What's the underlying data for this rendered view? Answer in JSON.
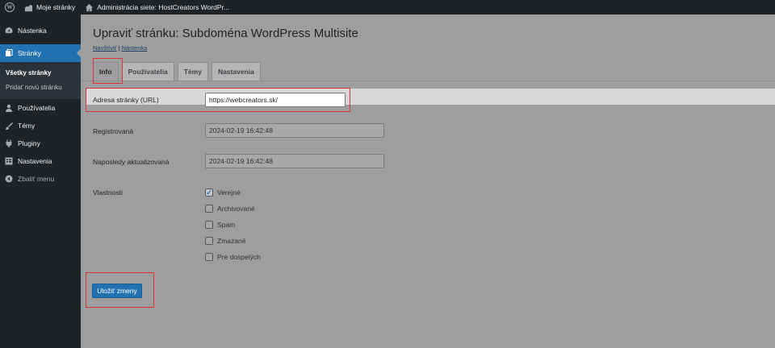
{
  "adminbar": {
    "my_sites": "Moje stránky",
    "site_name": "Administrácia siete: HostCreators WordPr..."
  },
  "sidebar": {
    "items": [
      {
        "label": "Nástenka",
        "icon": "dashboard-icon"
      },
      {
        "label": "Stránky",
        "icon": "pages-icon"
      },
      {
        "label": "Používatelia",
        "icon": "users-icon"
      },
      {
        "label": "Témy",
        "icon": "themes-icon"
      },
      {
        "label": "Pluginy",
        "icon": "plugins-icon"
      },
      {
        "label": "Nastavenia",
        "icon": "settings-icon"
      }
    ],
    "submenu": [
      "Všetky stránky",
      "Pridať novú stránku"
    ],
    "collapse": "Zbaliť menu"
  },
  "page": {
    "title": "Upraviť stránku: Subdoména WordPress Multisite",
    "link_visit": "Navštíviť",
    "separator": "|",
    "link_dashboard": "Nástenka"
  },
  "tabs": [
    "Info",
    "Používatelia",
    "Témy",
    "Nastavenia"
  ],
  "form": {
    "url_label": "Adresa stránky (URL)",
    "url_value": "https://webcreators.sk/",
    "registered_label": "Registrovaná",
    "registered_value": "2024-02-19 16:42:48",
    "updated_label": "Naposledy aktualizovaná",
    "updated_value": "2024-02-19 16:42:48",
    "properties_label": "Vlastnosti",
    "checkboxes": [
      {
        "label": "Verejné",
        "checked": true
      },
      {
        "label": "Archivované",
        "checked": false
      },
      {
        "label": "Spam",
        "checked": false
      },
      {
        "label": "Zmazané",
        "checked": false
      },
      {
        "label": "Pre dospelých",
        "checked": false
      }
    ],
    "save_label": "Uložiť zmeny"
  },
  "colors": {
    "accent": "#2271b1",
    "highlight": "#d63638",
    "sidebar_bg": "#1d2327"
  }
}
